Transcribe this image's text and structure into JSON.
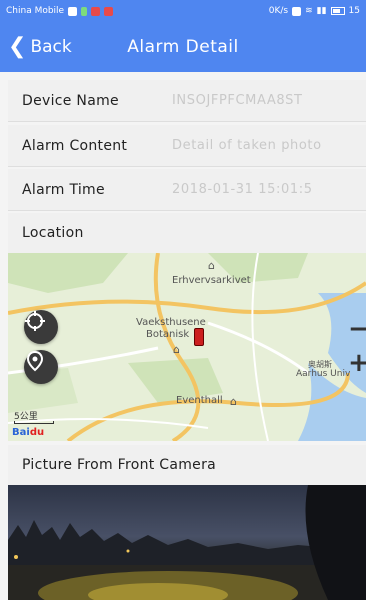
{
  "status_bar": {
    "carrier": "China Mobile",
    "network_speed": "0K/s",
    "time": "15"
  },
  "nav": {
    "back_label": "Back",
    "title": "Alarm Detail"
  },
  "details": [
    {
      "label": "Device Name",
      "value": "INSOJFPFCMAA8ST"
    },
    {
      "label": "Alarm Content",
      "value": "Detail of taken photo"
    },
    {
      "label": "Alarm Time",
      "value": "2018-01-31 15:01:5"
    }
  ],
  "location": {
    "title": "Location",
    "map_labels": {
      "erhvervsarkivet": "Erhvervsarkivet",
      "vaekst": "Vaeksthusene",
      "botanisk": "Botanisk",
      "aarhus": "Aarhus Univ",
      "aarhus_cn": "奥胡斯",
      "eventhall": "Eventhall",
      "scale": "5公里"
    },
    "baidu_logo": {
      "text": "Bai",
      "accent": "du"
    }
  },
  "camera": {
    "title": "Picture From Front Camera"
  },
  "colors": {
    "primary": "#4f86f0",
    "marker": "#cc1f1f"
  }
}
